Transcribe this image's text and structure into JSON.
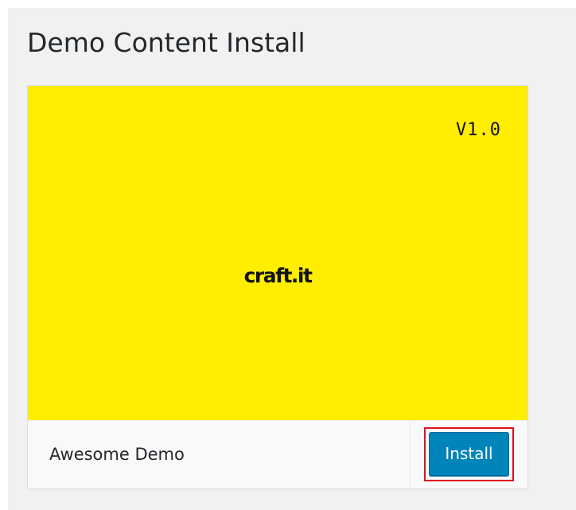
{
  "page": {
    "title": "Demo Content Install"
  },
  "demo": {
    "version": "V1.0",
    "brand": "craft.it",
    "name": "Awesome Demo",
    "install_label": "Install",
    "preview_color": "#ffee00",
    "button_color": "#0085ba",
    "highlight_color": "#e0101e"
  }
}
